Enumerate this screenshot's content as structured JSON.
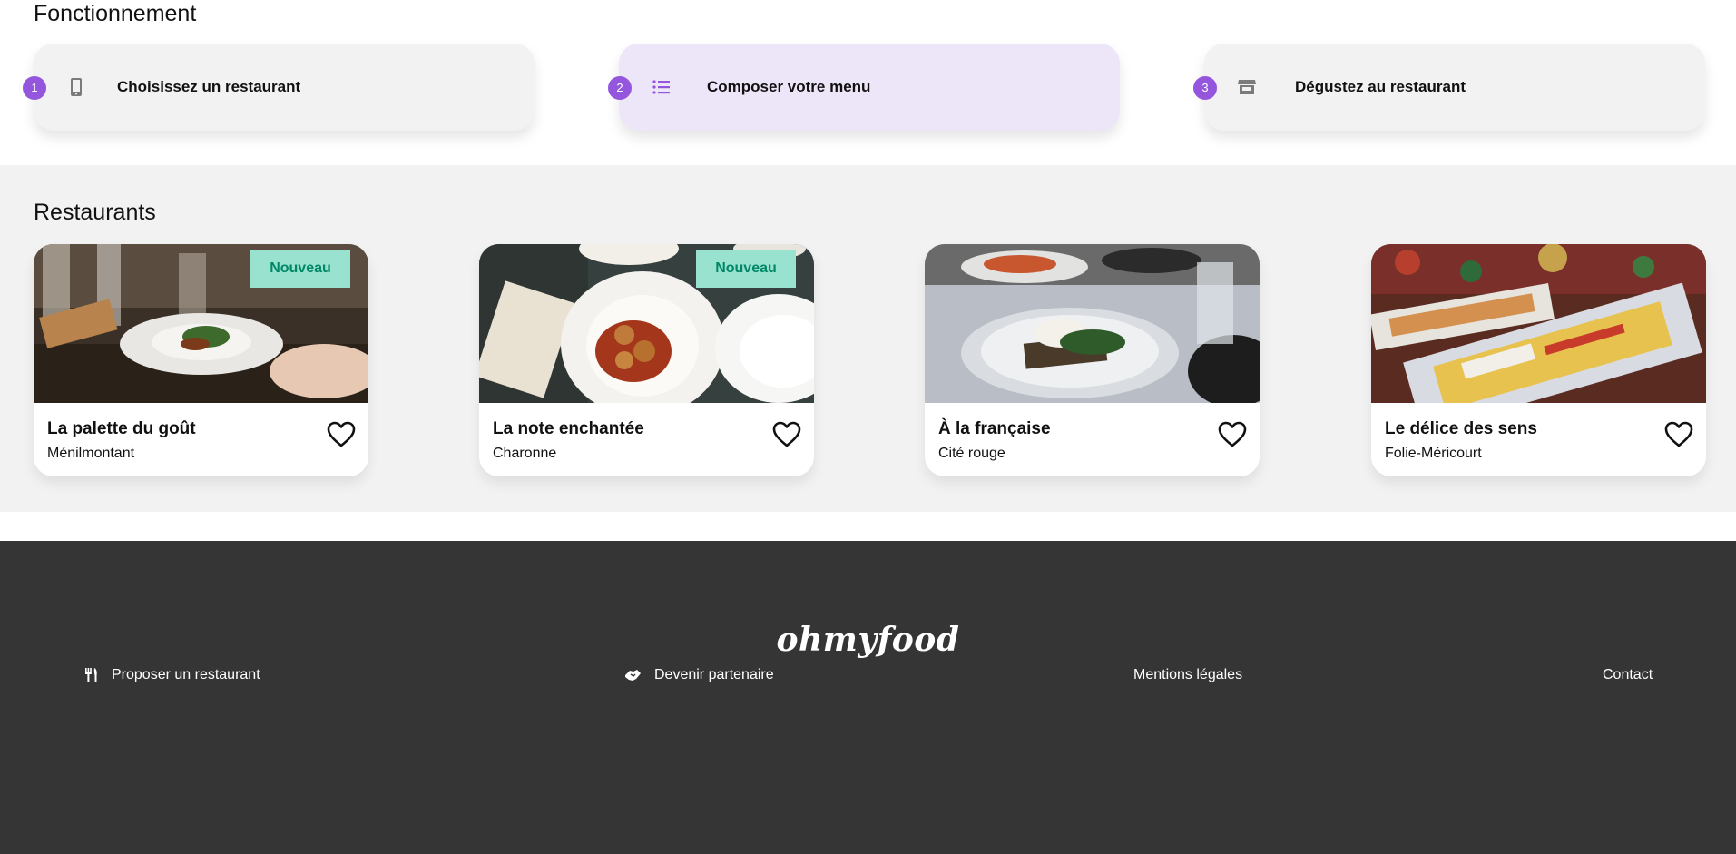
{
  "how": {
    "title": "Fonctionnement",
    "steps": [
      {
        "num": "1",
        "label": "Choisissez un restaurant",
        "icon": "phone-icon"
      },
      {
        "num": "2",
        "label": "Composer votre menu",
        "icon": "list-icon"
      },
      {
        "num": "3",
        "label": "Dégustez au restaurant",
        "icon": "store-icon"
      }
    ]
  },
  "restaurants": {
    "title": "Restaurants",
    "items": [
      {
        "name": "La palette du goût",
        "place": "Ménilmontant",
        "badge": "Nouveau"
      },
      {
        "name": "La note enchantée",
        "place": "Charonne",
        "badge": "Nouveau"
      },
      {
        "name": "À la française",
        "place": "Cité rouge"
      },
      {
        "name": "Le délice des sens",
        "place": "Folie-Méricourt"
      }
    ]
  },
  "footer": {
    "logo": "ohmyfood",
    "links": [
      "Proposer un restaurant",
      "Devenir partenaire",
      "Mentions légales",
      "Contact"
    ]
  },
  "colors": {
    "accent": "#9356dc",
    "badge_bg": "#99e2d0",
    "badge_text": "#008766",
    "footer_bg": "#353535"
  }
}
